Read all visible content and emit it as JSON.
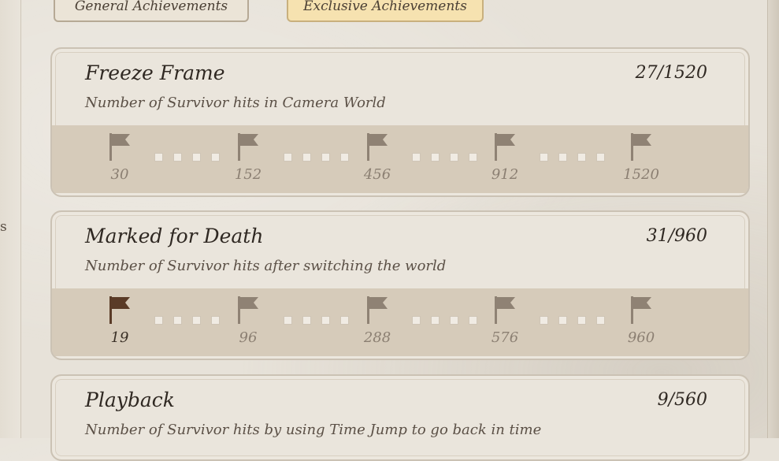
{
  "tabs": {
    "general": "General Achievements",
    "exclusive": "Exclusive Achievements"
  },
  "left_rail_text": "s",
  "colors": {
    "flag_inactive": "#8f8274",
    "flag_active": "#5a3b27",
    "tab_active_bg": "#f6e2b0"
  },
  "achievements": [
    {
      "title": "Freeze Frame",
      "progress": "27/1520",
      "description": "Number of Survivor hits in Camera World",
      "milestones": [
        {
          "value": "30",
          "reached": false
        },
        {
          "value": "152",
          "reached": false
        },
        {
          "value": "456",
          "reached": false
        },
        {
          "value": "912",
          "reached": false
        },
        {
          "value": "1520",
          "reached": false
        }
      ]
    },
    {
      "title": "Marked for Death",
      "progress": "31/960",
      "description": "Number of Survivor hits after switching the world",
      "milestones": [
        {
          "value": "19",
          "reached": true
        },
        {
          "value": "96",
          "reached": false
        },
        {
          "value": "288",
          "reached": false
        },
        {
          "value": "576",
          "reached": false
        },
        {
          "value": "960",
          "reached": false
        }
      ]
    },
    {
      "title": "Playback",
      "progress": "9/560",
      "description": "Number of Survivor hits by using Time Jump to go back in time"
    }
  ]
}
